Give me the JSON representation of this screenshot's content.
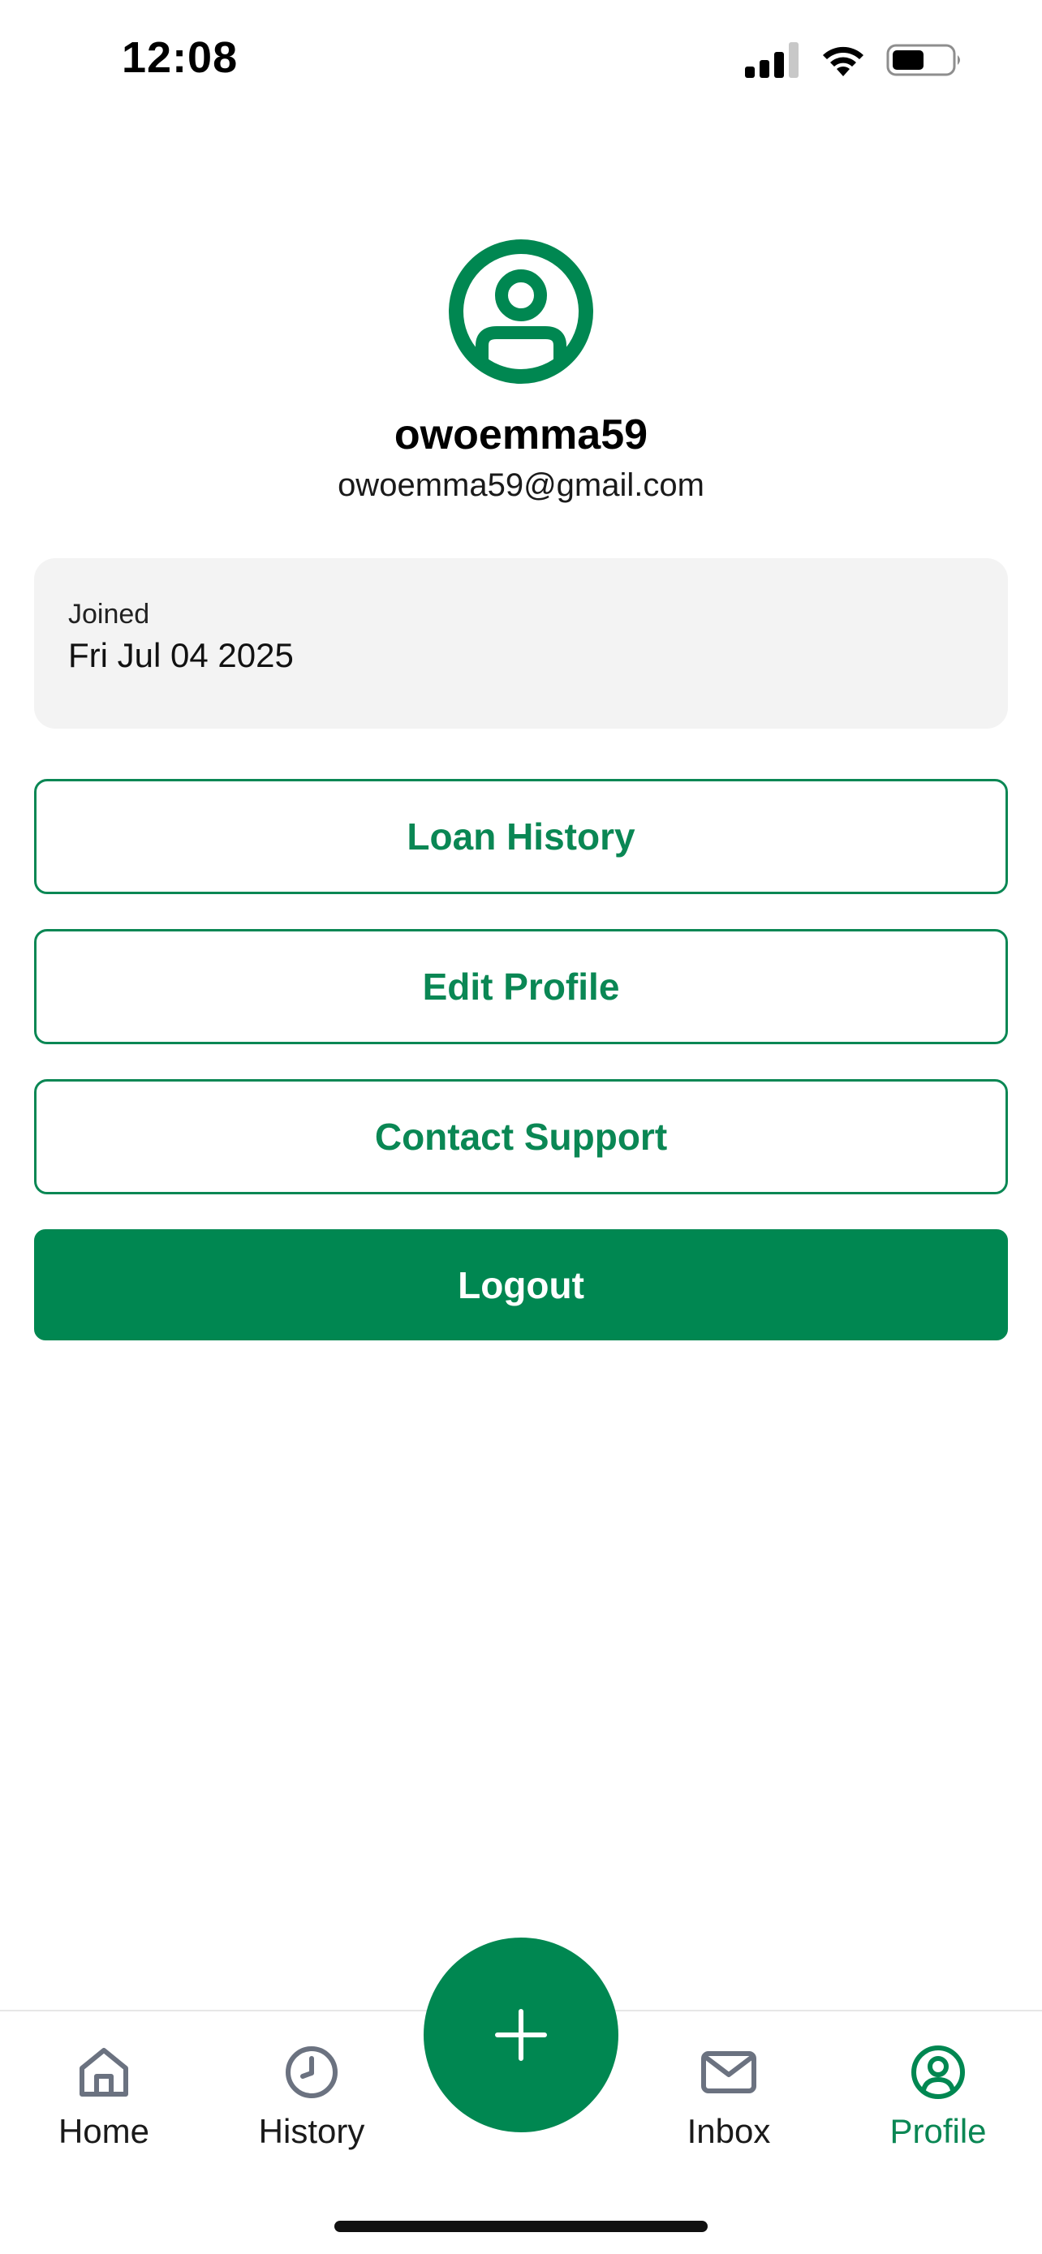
{
  "status_bar": {
    "time": "12:08"
  },
  "profile": {
    "username": "owoemma59",
    "email": "owoemma59@gmail.com",
    "joined_label": "Joined",
    "joined_date": "Fri Jul 04 2025"
  },
  "actions": {
    "loan_history": "Loan History",
    "edit_profile": "Edit Profile",
    "contact_support": "Contact Support",
    "logout": "Logout"
  },
  "tabs": [
    {
      "label": "Home",
      "icon": "home-icon",
      "active": false
    },
    {
      "label": "History",
      "icon": "clock-icon",
      "active": false
    },
    {
      "label": "Inbox",
      "icon": "mail-icon",
      "active": false
    },
    {
      "label": "Profile",
      "icon": "user-circle-icon",
      "active": true
    }
  ],
  "fab": {
    "icon": "plus-icon"
  },
  "colors": {
    "accent": "#008751",
    "card_background": "#f3f3f3",
    "inactive_icon": "#6b7280"
  }
}
